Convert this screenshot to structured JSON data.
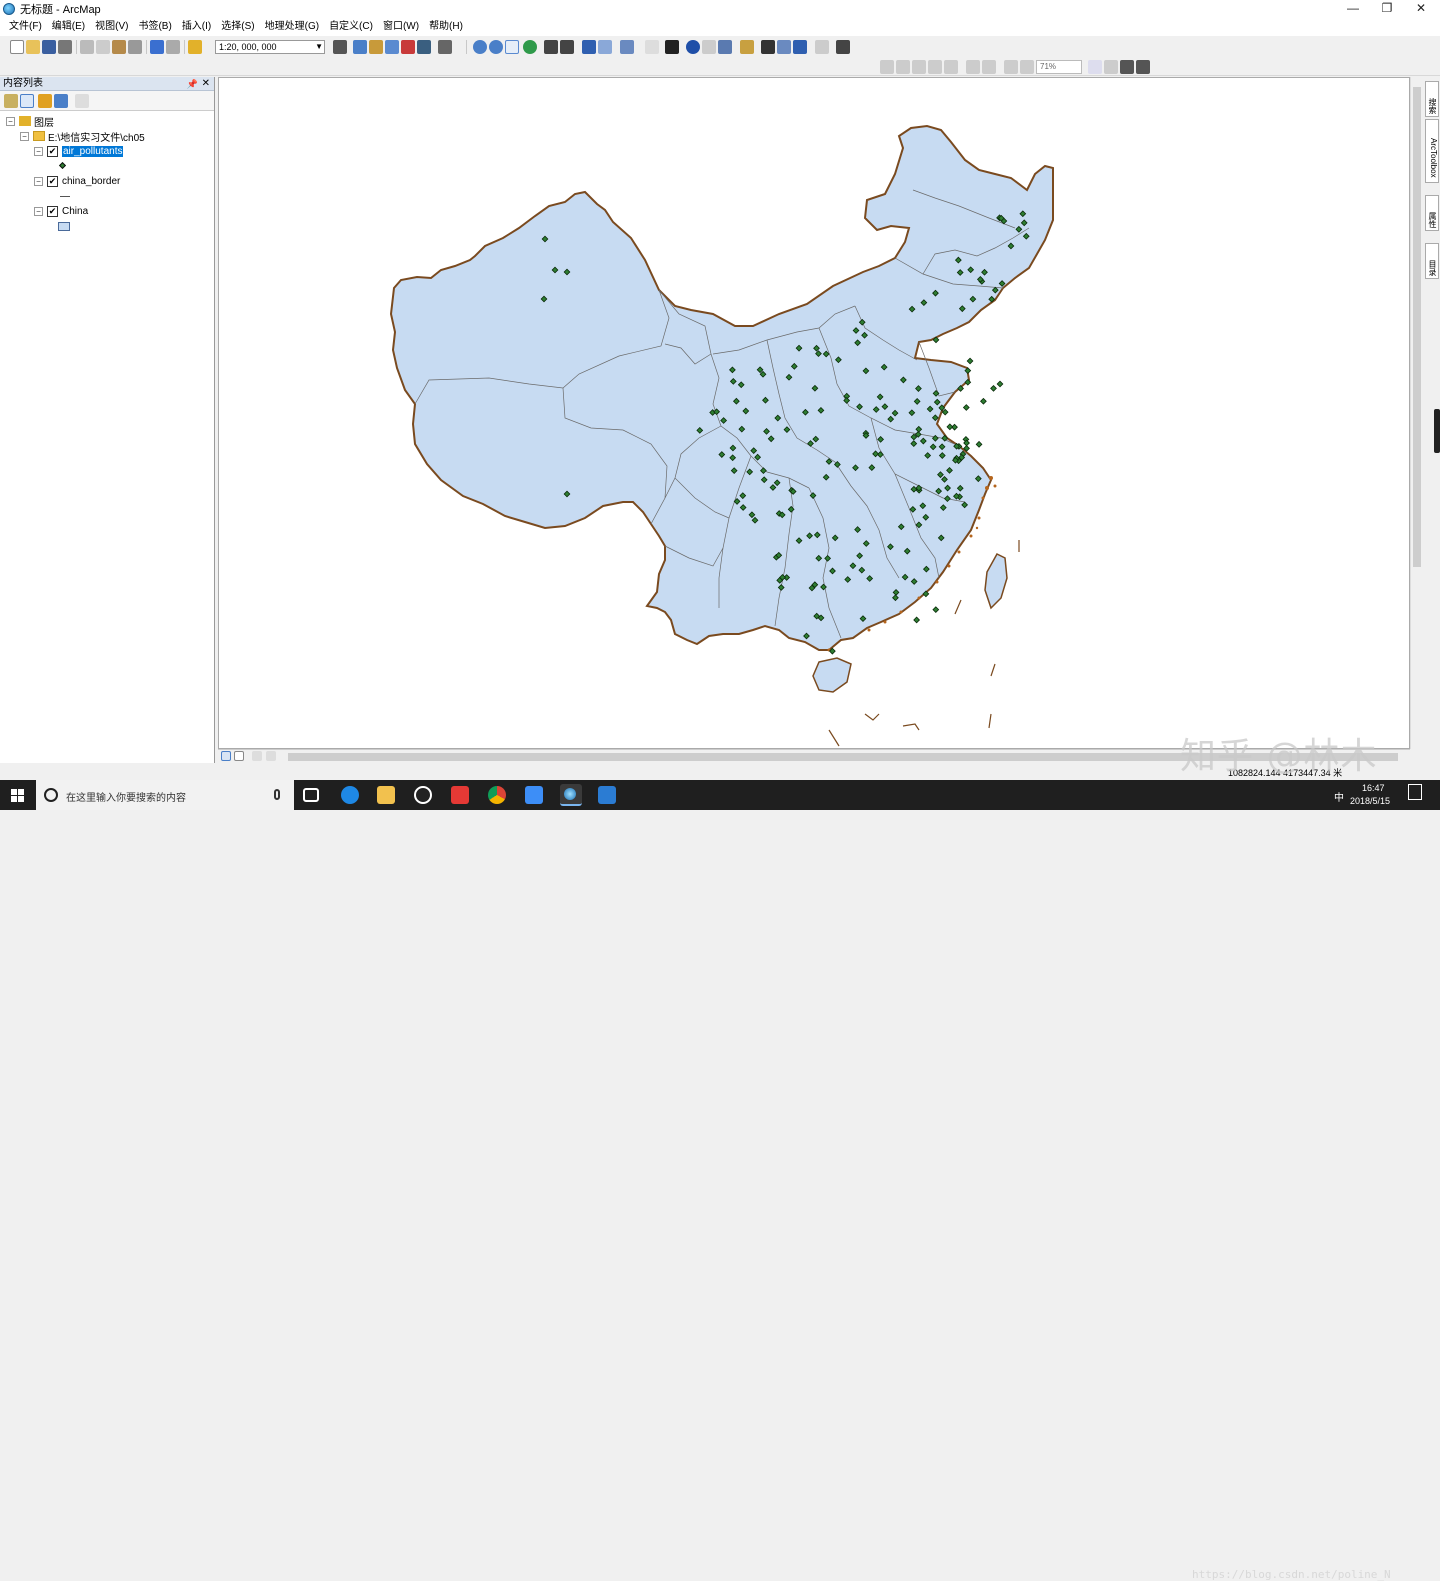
{
  "window": {
    "title": "无标题 - ArcMap",
    "minimize": "—",
    "restore": "❐",
    "close": "✕"
  },
  "menu": [
    "文件(F)",
    "编辑(E)",
    "视图(V)",
    "书签(B)",
    "插入(I)",
    "选择(S)",
    "地理处理(G)",
    "自定义(C)",
    "窗口(W)",
    "帮助(H)"
  ],
  "toolbar": {
    "scale": "1:20, 000, 000",
    "layout_zoom": "71%"
  },
  "toc": {
    "title": "内容列表",
    "root": "图层",
    "folder": "E:\\地信实习文件\\ch05",
    "layers": [
      {
        "name": "air_pollutants",
        "checked": true,
        "selected": true
      },
      {
        "name": "china_border",
        "checked": true,
        "selected": false
      },
      {
        "name": "China",
        "checked": true,
        "selected": false
      }
    ]
  },
  "right_dock": [
    "搜索",
    "ArcToolbox",
    "属性",
    "目录"
  ],
  "status": {
    "coordinates": "1082824.144  4173447.34 米"
  },
  "taskbar": {
    "search_placeholder": "在这里输入你要搜索的内容",
    "time": "16:47",
    "date": "2018/5/15",
    "ime": "中"
  },
  "watermark": {
    "text": "知乎 @林木",
    "url": "https://blog.csdn.net/poline_N"
  },
  "colors": {
    "land": "#c7dbf2",
    "border": "#7a4a1f",
    "point": "#2e7d32",
    "selection": "#0078d7"
  }
}
